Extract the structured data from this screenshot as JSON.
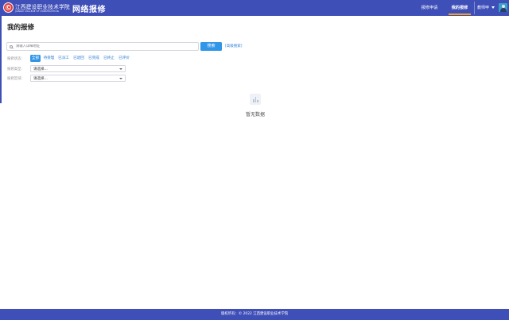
{
  "header": {
    "school_name_cn": "江西建设职业技术学院",
    "school_name_en": "JIANGXI COLLEGE OF CONSTRUCTION",
    "emblem_text": "C",
    "system_name": "网络报修",
    "nav": [
      {
        "label": "报修申请"
      },
      {
        "label": "我的报修"
      }
    ],
    "user_name": "教师甲"
  },
  "page": {
    "title": "我的报修"
  },
  "search": {
    "placeholder": "请输入详细地址",
    "button_label": "搜索",
    "advanced_label": "[高级搜索]"
  },
  "filters": {
    "status_label": "报修状态:",
    "status_options": [
      "全部",
      "待受理",
      "已派工",
      "已退回",
      "已完成",
      "已终止",
      "已评价"
    ],
    "status_selected": "全部",
    "type_label": "报修类型:",
    "type_value": "请选择...",
    "area_label": "报修区域:",
    "area_value": "请选择..."
  },
  "empty": {
    "text": "暂无数据"
  },
  "footer": {
    "text": "版权所有：© 2022 江西建设职业技术学院"
  },
  "colors": {
    "header_bg": "#3f4fb8",
    "accent_blue": "#3296e8",
    "active_tab_underline": "#f7a21b"
  }
}
